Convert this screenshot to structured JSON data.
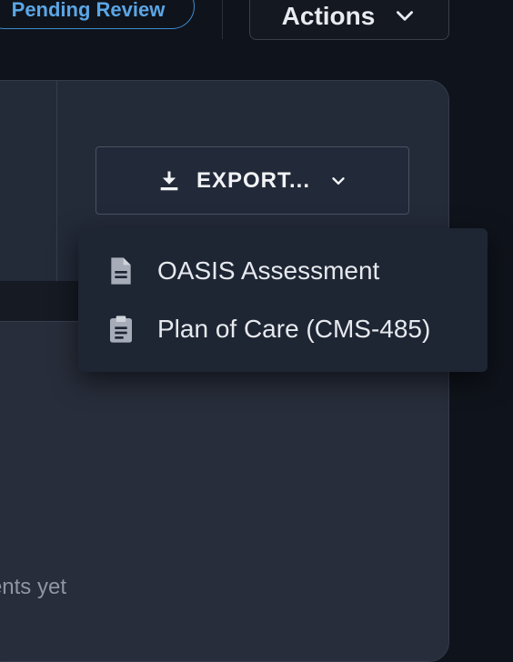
{
  "header": {
    "status_badge": "Pending Review",
    "actions_label": "Actions"
  },
  "card": {
    "export_label": "EXPORT...",
    "empty_state_text": "No documents yet"
  },
  "export_menu": {
    "items": [
      {
        "label": "OASIS Assessment",
        "icon": "document-icon"
      },
      {
        "label": "Plan of Care (CMS-485)",
        "icon": "clipboard-icon"
      }
    ]
  },
  "colors": {
    "background": "#0f131b",
    "card": "#232a38",
    "badge_accent": "#5aa6e6",
    "menu_bg": "#1e2533"
  }
}
